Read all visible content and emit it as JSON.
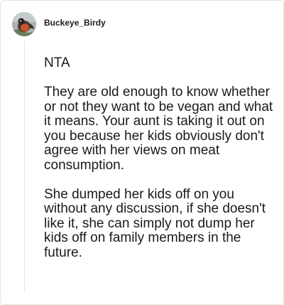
{
  "comment": {
    "username": "Buckeye_Birdy",
    "avatar_icon": "robin-bird-avatar",
    "paragraphs": [
      "NTA",
      "They are old enough to know whether or not they want to be vegan and what it means. Your aunt is taking it out on you because her kids obviously don't agree with her views on meat consumption.",
      "She dumped her kids off on you without any discussion, if she doesn't like it, she can simply not dump her kids off on family members in the future."
    ]
  },
  "colors": {
    "text": "#1a1a1b",
    "border": "#e4e4e4",
    "thread_line": "#e3e3e3"
  }
}
